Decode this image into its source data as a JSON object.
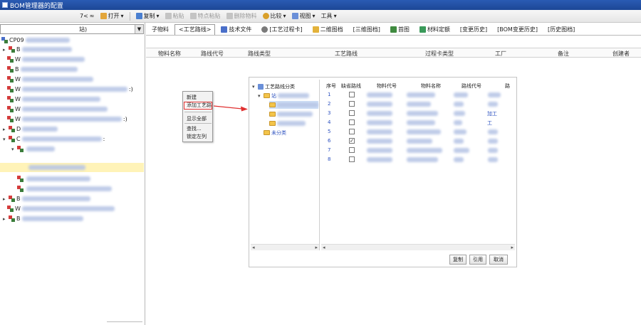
{
  "window": {
    "title": "BOM管理器的配置"
  },
  "toolbar": {
    "combo_value": "7<",
    "open_label": "打开",
    "copy_label": "复制",
    "paste_label": "粘贴",
    "paste_special_label": "特点粘贴",
    "delete_label": "删除物料",
    "compare_label": "比较",
    "view_label": "视图",
    "tools_label": "工具"
  },
  "sidebar": {
    "combo_value": "站)",
    "items": [
      {
        "label": "CP09"
      },
      {
        "label": "B"
      },
      {
        "label": "W"
      },
      {
        "label": "B"
      },
      {
        "label": "W"
      },
      {
        "label": "W"
      },
      {
        "label": "W"
      },
      {
        "label": "W"
      },
      {
        "label": "W"
      },
      {
        "label": "D"
      },
      {
        "label": "C"
      },
      {
        "label": ""
      },
      {
        "label": ""
      },
      {
        "label": ""
      },
      {
        "label": ""
      },
      {
        "label": "B"
      },
      {
        "label": "W"
      },
      {
        "label": "B"
      }
    ],
    "suffix_marks": [
      ":)",
      ":)",
      ":"
    ]
  },
  "tabs": [
    {
      "label": "子物料"
    },
    {
      "label": "<工艺路线>"
    },
    {
      "label": "技术文件"
    },
    {
      "label": "[工艺过程卡]"
    },
    {
      "label": "二维图档"
    },
    {
      "label": "[三维图档]"
    },
    {
      "label": "首图"
    },
    {
      "label": "材料定额"
    },
    {
      "label": "[变更历史]"
    },
    {
      "label": "[BOM变更历史]"
    },
    {
      "label": "[历史图档]"
    }
  ],
  "grid": {
    "headers": [
      "物料名称",
      "路线代号",
      "路线类型",
      "工艺路线",
      "过程卡类型",
      "工厂",
      "备注",
      "创建者"
    ]
  },
  "context_menu": {
    "items": [
      "新建",
      "添加工艺路",
      "显示全部",
      "查找...",
      "锁定左列"
    ]
  },
  "dialog": {
    "tree_root": "工艺路线分类",
    "tree_child": "站",
    "tree_other": "未分类",
    "headers": [
      "序号",
      "缺省路线",
      "物料代号",
      "物料名称",
      "路线代号",
      "路"
    ],
    "rows": [
      {
        "num": "1",
        "checked": false,
        "side": ""
      },
      {
        "num": "2",
        "checked": false,
        "side": ""
      },
      {
        "num": "3",
        "checked": false,
        "side": "加工"
      },
      {
        "num": "4",
        "checked": false,
        "side": "工"
      },
      {
        "num": "5",
        "checked": false,
        "side": ""
      },
      {
        "num": "6",
        "checked": true,
        "side": ""
      },
      {
        "num": "7",
        "checked": false,
        "side": ""
      },
      {
        "num": "8",
        "checked": false,
        "side": ""
      }
    ],
    "check_mark": "✓",
    "buttons": {
      "copy": "复制",
      "reference": "引用",
      "cancel": "取消"
    }
  },
  "colors": {
    "title_bar": "#1d4796",
    "highlight_border": "#e03030",
    "selection": "#fff3b8"
  }
}
